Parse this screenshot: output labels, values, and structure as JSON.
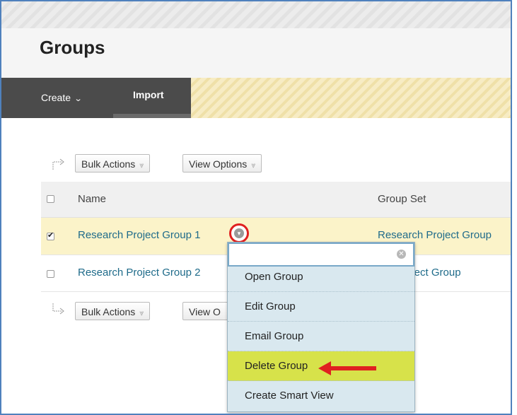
{
  "page": {
    "title": "Groups"
  },
  "action_bar": {
    "create_label": "Create",
    "import_label": "Import"
  },
  "toolbar": {
    "bulk_actions": "Bulk Actions",
    "view_options": "View Options"
  },
  "bottom_toolbar": {
    "bulk_actions": "Bulk Actions",
    "view_options": "View O"
  },
  "table": {
    "columns": [
      "Name",
      "Group Set"
    ],
    "rows": [
      {
        "name": "Research Project Group 1",
        "group_set": "Research Project Group",
        "checked": true
      },
      {
        "name": "Research Project Group 2",
        "group_set": "rch Project Group",
        "checked": false
      }
    ]
  },
  "context_menu": {
    "search_value": "",
    "items": [
      "Open Group",
      "Edit Group",
      "Email Group",
      "Delete Group",
      "Create Smart View"
    ],
    "highlighted": "Delete Group"
  },
  "colors": {
    "link": "#1f6b8a",
    "highlight": "#d7e24a",
    "annotation_red": "#e02020",
    "action_bar_dark": "#4b4b4b"
  }
}
